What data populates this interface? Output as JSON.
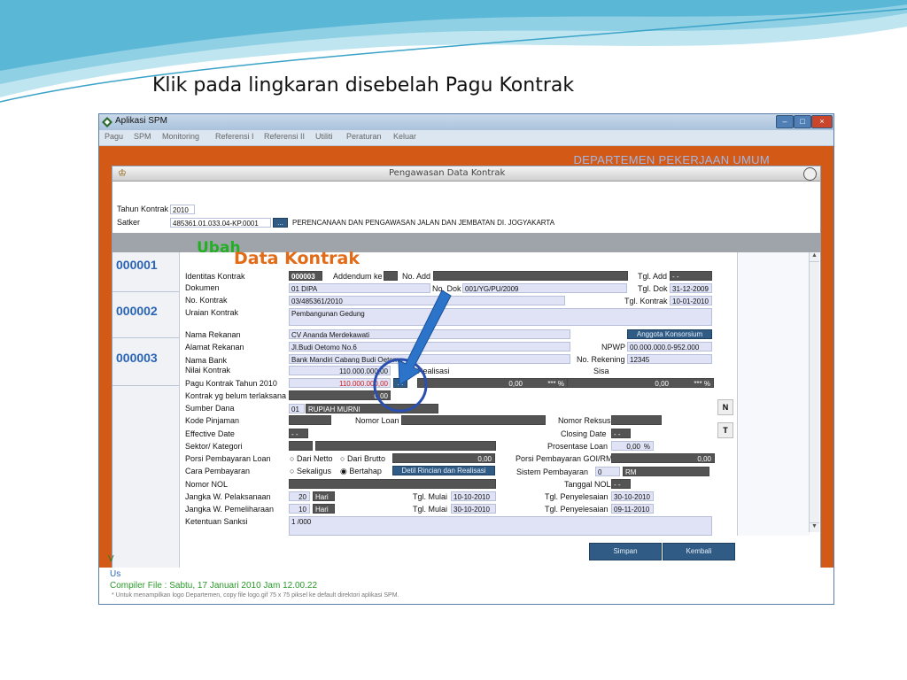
{
  "slide": {
    "title": "Klik pada lingkaran disebelah Pagu Kontrak"
  },
  "app": {
    "title": "Aplikasi SPM",
    "menu": [
      "Pagu",
      "SPM",
      "Monitoring",
      "Referensi I",
      "Referensi II",
      "Utiliti",
      "Peraturan",
      "Keluar"
    ],
    "department": "DEPARTEMEN PEKERJAAN UMUM",
    "window_title": "Pengawasan Data Kontrak",
    "footnote": "* Untuk menampilkan logo Departemen, copy file logo.gif 75 x 75 piksel ke default direktori aplikasi SPM.",
    "bottom_left_fragments": [
      "V",
      "Us",
      "Compiler File : Sabtu, 17 Januari 2010 Jam 12.00.22"
    ]
  },
  "top": {
    "tahun_label": "Tahun Kontrak",
    "tahun_value": "2010",
    "satker_label": "Satker",
    "satker_code": "485361.01.033.04-KP.0001",
    "satker_btn": "...",
    "satker_name": "PERENCANAAN DAN PENGAWASAN JALAN DAN JEMBATAN DI. JOGYAKARTA"
  },
  "heading": {
    "ubah": "Ubah",
    "data_kontrak": "Data Kontrak"
  },
  "rows": [
    "000001",
    "000002",
    "000003"
  ],
  "side_buttons": [
    "N",
    "T"
  ],
  "form": {
    "identitas_label": "Identitas Kontrak",
    "identitas_value": "000003",
    "addendum_label": "Addendum ke",
    "noadd_label": "No. Add",
    "tgladd_label": "Tgl. Add",
    "tgladd_value": "- -",
    "dokumen_label": "Dokumen",
    "dokumen_value": "01  DIPA",
    "nodok_label": "No. Dok",
    "nodok_value": "001/YG/PU/2009",
    "tgldok_label": "Tgl. Dok",
    "tgldok_value": "31-12-2009",
    "nokontrak_label": "No. Kontrak",
    "nokontrak_value": "03/485361/2010",
    "tglkontrak_label": "Tgl. Kontrak",
    "tglkontrak_value": "10-01-2010",
    "uraian_label": "Uraian Kontrak",
    "uraian_value": "Pembangunan Gedung",
    "rekanan_label": "Nama Rekanan",
    "rekanan_value": "CV Ananda Merdekawati",
    "konsorsium_btn": "Anggota Konsorsium",
    "alamat_label": "Alamat Rekanan",
    "alamat_value": "Jl.Budi Oetomo No.6",
    "npwp_label": "NPWP",
    "npwp_value": "00.000.000.0-952.000",
    "bank_label": "Nama Bank",
    "bank_value": "Bank Mandiri Cabang Budi Oetomo",
    "norek_label": "No. Rekening",
    "norek_value": "12345",
    "nilai_label": "Nilai Kontrak",
    "nilai_value": "110.000.000,00",
    "realisasi_label": "Realisasi",
    "sisa_label": "Sisa",
    "pagu_label": "Pagu Kontrak Tahun 2010",
    "pagu_value": "110.000.000,00",
    "pagu_btn": "...",
    "real_value": "0,00",
    "real_pct": "*** %",
    "sisa_value": "0,00",
    "sisa_pct": "*** %",
    "belum_label": "Kontrak yg belum terlaksana",
    "belum_value": "0,00",
    "sumber_label": "Sumber Dana",
    "sumber_code": "01",
    "sumber_value": "RUPIAH MURNI",
    "kodepinjaman_label": "Kode Pinjaman",
    "noloan_label": "Nomor Loan",
    "noreksus_label": "Nomor Reksus",
    "effdate_label": "Effective Date",
    "effdate_value": "- -",
    "closing_label": "Closing Date",
    "closing_value": "- -",
    "sektor_label": "Sektor/ Kategori",
    "prosentase_label": "Prosentase Loan",
    "prosentase_value": "0,00",
    "prosentase_pct": "%",
    "porsi_label": "Porsi Pembayaran Loan",
    "dari_netto": "Dari Netto",
    "dari_brutto": "Dari Brutto",
    "porsi_value": "0,00",
    "porsigoi_label": "Porsi Pembayaran GOI/RM",
    "porsigoi_value": "0,00",
    "cara_label": "Cara Pembayaran",
    "sekaligus": "Sekaligus",
    "bertahap": "Bertahap",
    "detil_btn": "Detil Rincian dan Realisasi",
    "sistem_label": "Sistem Pembayaran",
    "sistem_code": "0",
    "sistem_value": "RM",
    "nomornol_label": "Nomor NOL",
    "tglnol_label": "Tanggal NOL",
    "tglnol_value": "- -",
    "jangka_pel_label": "Jangka W. Pelaksanaan",
    "jangka_pel_num": "20",
    "jangka_pel_unit": "Hari",
    "tglmulai1_label": "Tgl. Mulai",
    "tglmulai1_value": "10-10-2010",
    "tglpeny1_label": "Tgl. Penyelesaian",
    "tglpeny1_value": "30-10-2010",
    "jangka_pem_label": "Jangka W. Pemeliharaan",
    "jangka_pem_num": "10",
    "jangka_pem_unit": "Hari",
    "tglmulai2_label": "Tgl. Mulai",
    "tglmulai2_value": "30-10-2010",
    "tglpeny2_label": "Tgl. Penyelesaian",
    "tglpeny2_value": "09-11-2010",
    "sanksi_label": "Ketentuan Sanksi",
    "sanksi_value": "1 /000"
  },
  "buttons": {
    "simpan": "Simpan",
    "kembali": "Kembali"
  },
  "colors": {
    "accent_orange": "#d35a16",
    "arrow_blue": "#2b74c9",
    "highlight_circle": "#2a4fb0"
  }
}
